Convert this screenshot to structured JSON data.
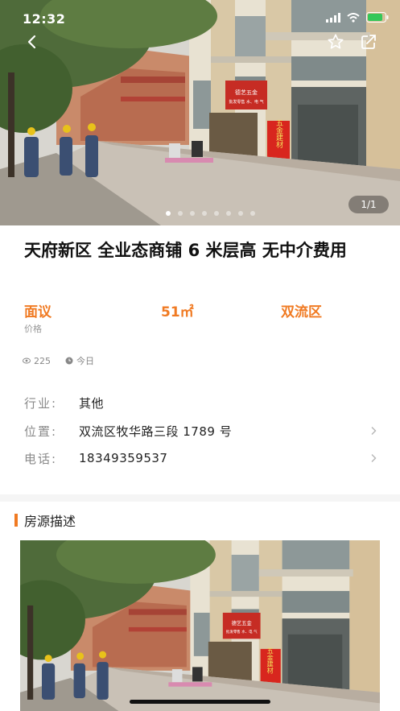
{
  "status_bar": {
    "time": "12:32"
  },
  "gallery": {
    "pager_text": "1/1"
  },
  "storefront_signs": {
    "hardware_sign": "五金建材",
    "banner_top": "德艺五金",
    "banner_bottom": "批发零售 水、电 气"
  },
  "listing": {
    "title": "天府新区 全业态商铺 6 米层高 无中介费用",
    "price": "面议",
    "price_label": "价格",
    "area": "51㎡",
    "district": "双流区",
    "views": "225",
    "posted": "今日"
  },
  "details": [
    {
      "label": "行业:",
      "value": "其他",
      "has_arrow": false
    },
    {
      "label": "位置:",
      "value": "双流区牧华路三段 1789 号",
      "has_arrow": true
    },
    {
      "label": "电话:",
      "value": "18349359537",
      "has_arrow": true
    }
  ],
  "description": {
    "heading": "房源描述"
  },
  "colors": {
    "accent": "#f07a22",
    "label_gray": "#8a8a8a"
  },
  "icons": [
    "back-arrow-icon",
    "star-icon",
    "share-icon",
    "eye-icon",
    "clock-icon",
    "chevron-right-icon",
    "signal-icon",
    "wifi-icon",
    "battery-icon"
  ]
}
